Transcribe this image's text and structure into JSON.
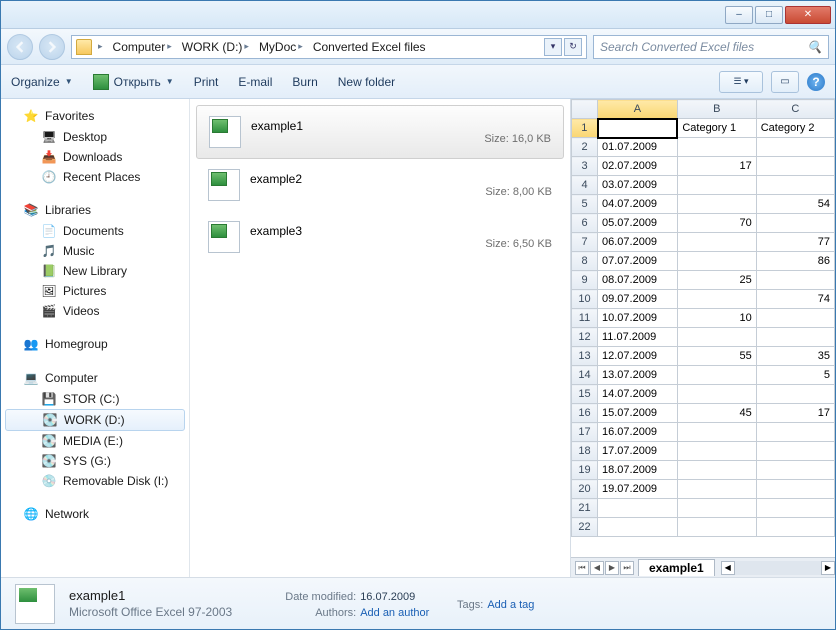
{
  "window": {
    "minimize": "–",
    "maximize": "□",
    "close": "✕"
  },
  "breadcrumb": [
    "Computer",
    "WORK (D:)",
    "MyDoc",
    "Converted Excel files"
  ],
  "search": {
    "placeholder": "Search Converted Excel files"
  },
  "toolbar": {
    "organize": "Organize",
    "open": "Открыть",
    "print": "Print",
    "email": "E-mail",
    "burn": "Burn",
    "newfolder": "New folder"
  },
  "sidebar": {
    "favorites": {
      "label": "Favorites",
      "items": [
        "Desktop",
        "Downloads",
        "Recent Places"
      ]
    },
    "libraries": {
      "label": "Libraries",
      "items": [
        "Documents",
        "Music",
        "New Library",
        "Pictures",
        "Videos"
      ]
    },
    "homegroup": {
      "label": "Homegroup"
    },
    "computer": {
      "label": "Computer",
      "items": [
        "STOR (C:)",
        "WORK (D:)",
        "MEDIA (E:)",
        "SYS (G:)",
        "Removable Disk (I:)"
      ],
      "selected": 1
    },
    "network": {
      "label": "Network"
    }
  },
  "files": [
    {
      "name": "example1",
      "size": "Size: 16,0 KB",
      "selected": true
    },
    {
      "name": "example2",
      "size": "Size: 8,00 KB",
      "selected": false
    },
    {
      "name": "example3",
      "size": "Size: 6,50 KB",
      "selected": false
    }
  ],
  "preview": {
    "columns": [
      "A",
      "B",
      "C"
    ],
    "headers": [
      "",
      "Category 1",
      "Category 2"
    ],
    "rows": [
      [
        "01.07.2009",
        "",
        ""
      ],
      [
        "02.07.2009",
        "17",
        ""
      ],
      [
        "03.07.2009",
        "",
        ""
      ],
      [
        "04.07.2009",
        "",
        "54"
      ],
      [
        "05.07.2009",
        "70",
        ""
      ],
      [
        "06.07.2009",
        "",
        "77"
      ],
      [
        "07.07.2009",
        "",
        "86"
      ],
      [
        "08.07.2009",
        "25",
        ""
      ],
      [
        "09.07.2009",
        "",
        "74"
      ],
      [
        "10.07.2009",
        "10",
        ""
      ],
      [
        "11.07.2009",
        "",
        ""
      ],
      [
        "12.07.2009",
        "55",
        "35"
      ],
      [
        "13.07.2009",
        "",
        "5"
      ],
      [
        "14.07.2009",
        "",
        ""
      ],
      [
        "15.07.2009",
        "45",
        "17"
      ],
      [
        "16.07.2009",
        "",
        ""
      ],
      [
        "17.07.2009",
        "",
        ""
      ],
      [
        "18.07.2009",
        "",
        ""
      ],
      [
        "19.07.2009",
        "",
        ""
      ],
      [
        "",
        "",
        ""
      ],
      [
        "",
        "",
        ""
      ]
    ],
    "tab": "example1"
  },
  "details": {
    "name": "example1",
    "type": "Microsoft Office Excel 97-2003",
    "date_modified_label": "Date modified:",
    "date_modified": "16.07.2009",
    "authors_label": "Authors:",
    "authors": "Add an author",
    "tags_label": "Tags:",
    "tags": "Add a tag"
  }
}
